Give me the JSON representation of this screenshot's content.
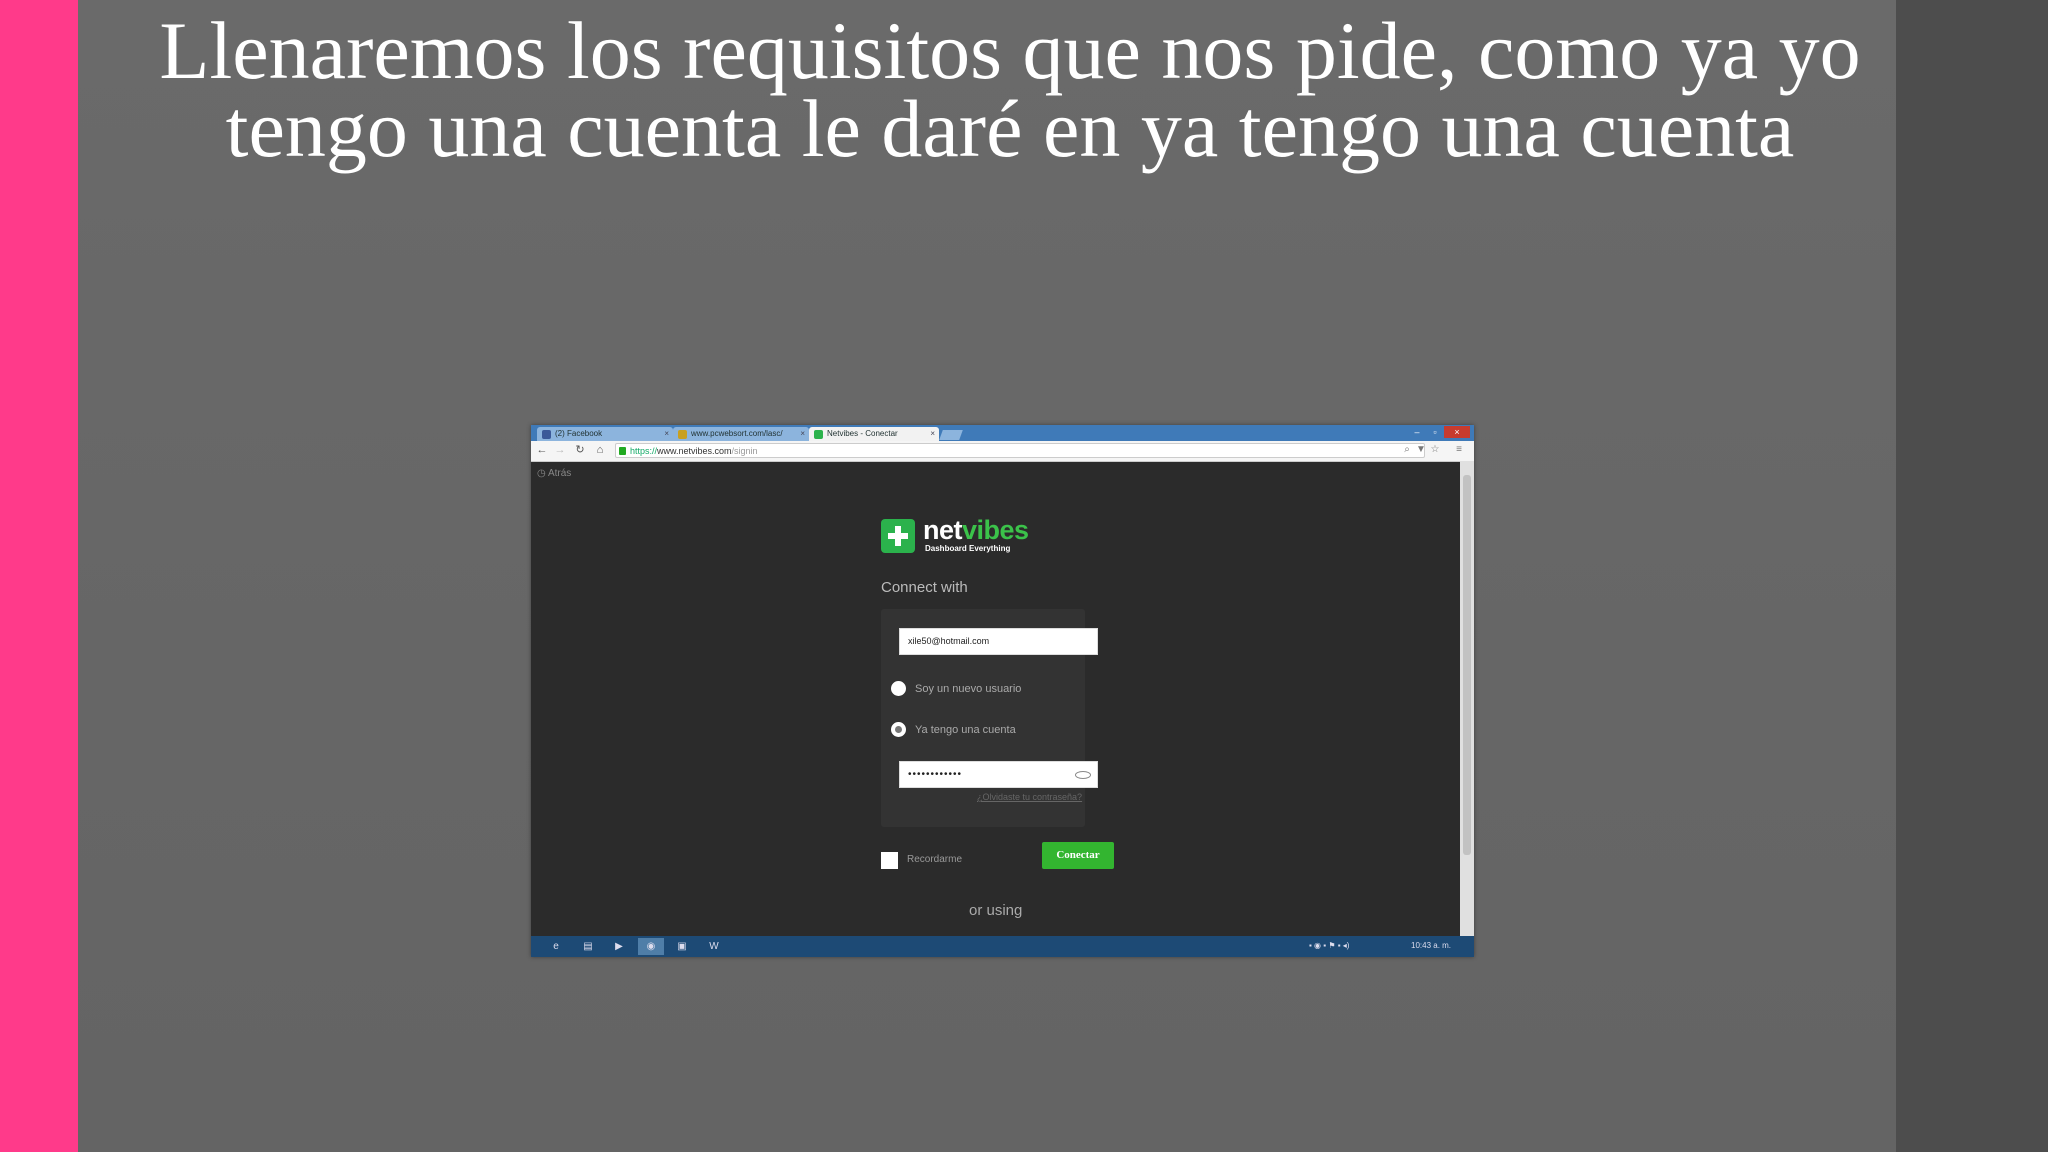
{
  "slide": {
    "title": "Llenaremos los requisitos que nos pide, como ya yo tengo una cuenta le daré en ya tengo una cuenta"
  },
  "browser": {
    "tabs": [
      {
        "label": "(2) Facebook",
        "favicon_color": "#3b5998"
      },
      {
        "label": "www.pcwebsort.com/lasc/",
        "favicon_color": "#c8a020"
      },
      {
        "label": "Netvibes - Conectar",
        "favicon_color": "#2bb24c",
        "active": true
      }
    ],
    "url_scheme": "https://",
    "url_host": "www.netvibes.com",
    "url_path": "/signin"
  },
  "page": {
    "back_link": "Atrás",
    "logo_net": "net",
    "logo_vibes": "vibes",
    "logo_tagline": "Dashboard Everything",
    "connect_with": "Connect with",
    "email_value": "xile50@hotmail.com",
    "radio_new": "Soy un nuevo usuario",
    "radio_existing": "Ya tengo una cuenta",
    "password_value": "••••••••••••",
    "forgot": "¿Olvidaste tu contraseña?",
    "remember": "Recordarme",
    "connect_button": "Conectar",
    "or_using": "or using"
  },
  "taskbar": {
    "clock": "10:43 a. m."
  },
  "colors": {
    "accent_pink": "#ff3a8a",
    "netvibes_green": "#2bb24c"
  }
}
